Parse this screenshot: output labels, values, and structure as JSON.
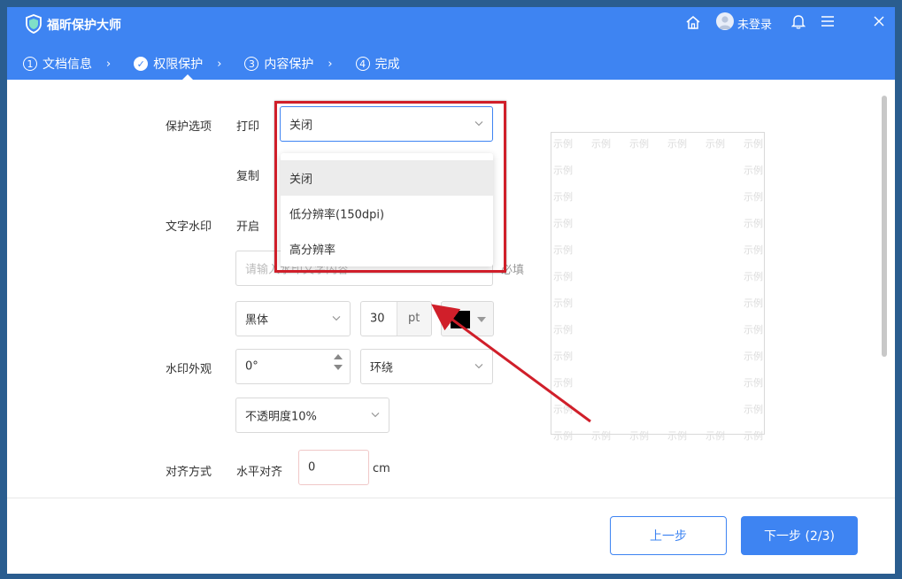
{
  "app": {
    "title": "福昕保护大师",
    "login": "未登录"
  },
  "steps": [
    {
      "num": "1",
      "label": "文档信息"
    },
    {
      "num": "✓",
      "label": "权限保护"
    },
    {
      "num": "3",
      "label": "内容保护"
    },
    {
      "num": "4",
      "label": "完成"
    }
  ],
  "form": {
    "protect_label": "保护选项",
    "print_label": "打印",
    "print_value": "关闭",
    "copy_label": "复制",
    "watermark_label": "文字水印",
    "watermark_on": "开启",
    "watermark_placeholder": "请输入水印文字内容",
    "required_hint": "必填",
    "font_value": "黑体",
    "size_value": "30",
    "size_unit": "pt",
    "appearance_label": "水印外观",
    "rotation_value": "0°",
    "layout_value": "环绕",
    "opacity_value": "不透明度10%",
    "align_label": "对齐方式",
    "halign_label": "水平对齐",
    "halign_value": "0",
    "halign_unit": "cm"
  },
  "print_options": [
    "关闭",
    "低分辨率(150dpi)",
    "高分辨率"
  ],
  "preview": {
    "watermark_text": "示例"
  },
  "footer": {
    "prev": "上一步",
    "next": "下一步 (2/3)"
  },
  "colors": {
    "accent": "#3e84f2",
    "highlight": "#d01f2a",
    "watermark_color": "#000000"
  }
}
